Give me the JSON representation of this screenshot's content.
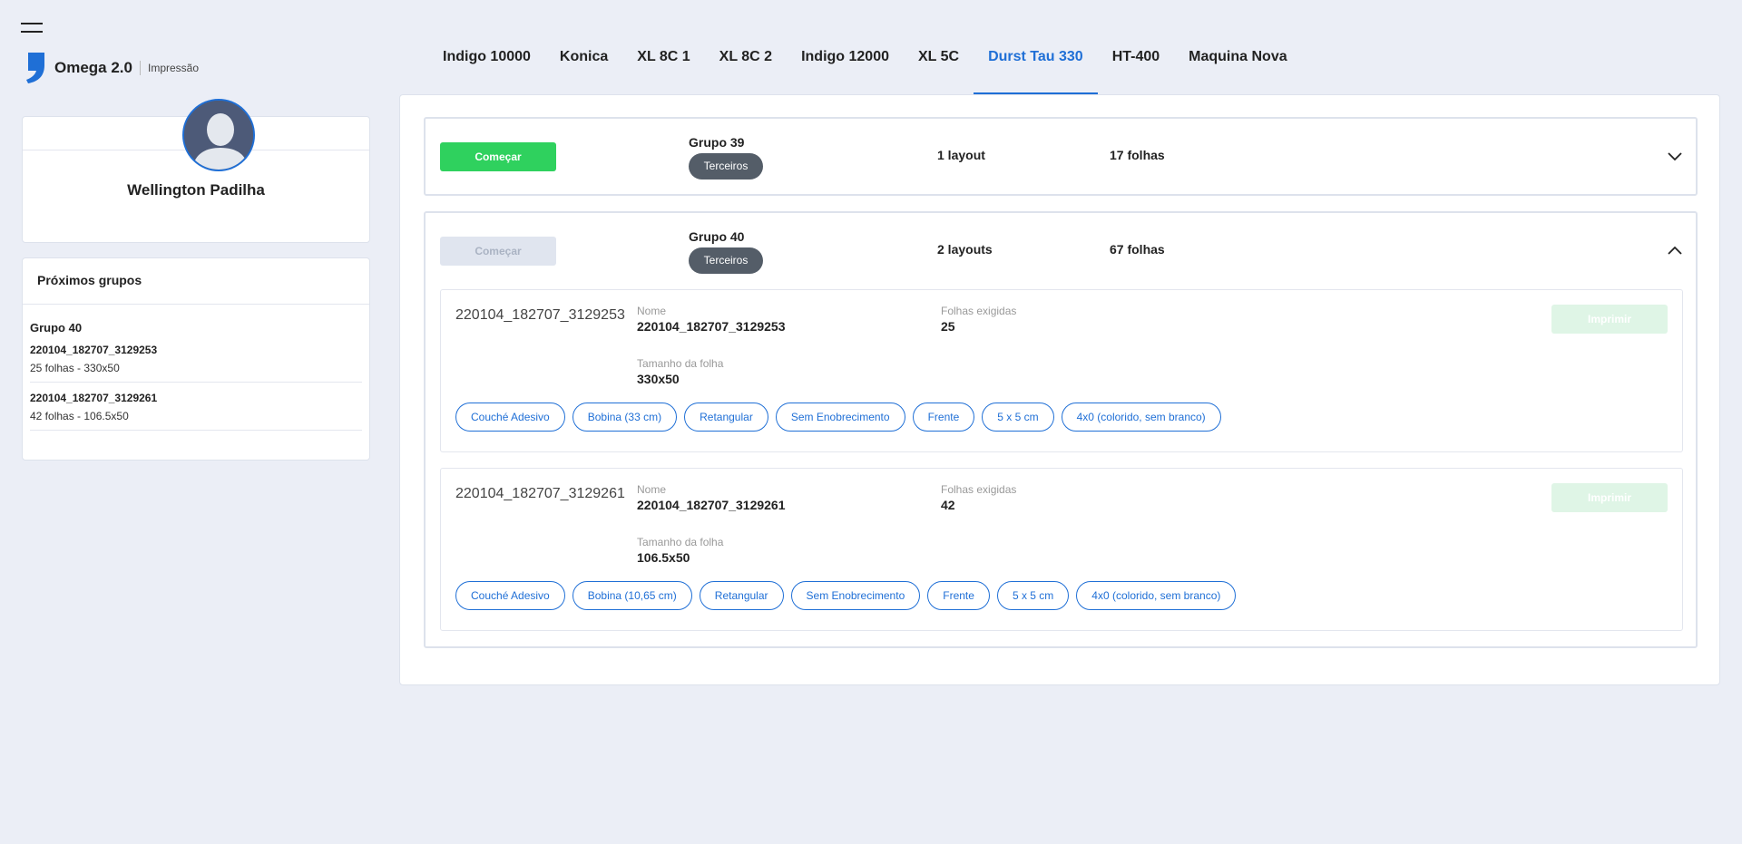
{
  "brand": {
    "name": "Omega 2.0",
    "sub": "Impressão"
  },
  "tabs": [
    {
      "label": "Indigo 10000"
    },
    {
      "label": "Konica"
    },
    {
      "label": "XL 8C 1"
    },
    {
      "label": "XL 8C 2"
    },
    {
      "label": "Indigo 12000"
    },
    {
      "label": "XL 5C"
    },
    {
      "label": "Durst Tau 330",
      "active": true
    },
    {
      "label": "HT-400"
    },
    {
      "label": "Maquina Nova"
    }
  ],
  "profile": {
    "name": "Wellington Padilha"
  },
  "next_groups": {
    "title": "Próximos grupos",
    "group": "Grupo 40",
    "items": [
      {
        "title": "220104_182707_3129253",
        "subtitle": "25 folhas - 330x50"
      },
      {
        "title": "220104_182707_3129261",
        "subtitle": "42 folhas - 106.5x50"
      }
    ]
  },
  "groups": [
    {
      "start_label": "Começar",
      "title": "Grupo 39",
      "badge": "Terceiros",
      "layouts": "1 layout",
      "folhas": "17 folhas",
      "expanded": false
    },
    {
      "start_label": "Começar",
      "title": "Grupo 40",
      "badge": "Terceiros",
      "layouts": "2 layouts",
      "folhas": "67 folhas",
      "expanded": true,
      "layout_items": [
        {
          "image_alt": "220104_182707_3129253",
          "name_label": "Nome",
          "name": "220104_182707_3129253",
          "folhas_label": "Folhas exigidas",
          "folhas": "25",
          "size_label": "Tamanho da folha",
          "size": "330x50",
          "print_label": "Imprimir",
          "chips": [
            "Couché Adesivo",
            "Bobina (33 cm)",
            "Retangular",
            "Sem Enobrecimento",
            "Frente",
            "5 x 5 cm",
            "4x0 (colorido, sem branco)"
          ]
        },
        {
          "image_alt": "220104_182707_3129261",
          "name_label": "Nome",
          "name": "220104_182707_3129261",
          "folhas_label": "Folhas exigidas",
          "folhas": "42",
          "size_label": "Tamanho da folha",
          "size": "106.5x50",
          "print_label": "Imprimir",
          "chips": [
            "Couché Adesivo",
            "Bobina (10,65 cm)",
            "Retangular",
            "Sem Enobrecimento",
            "Frente",
            "5 x 5 cm",
            "4x0 (colorido, sem branco)"
          ]
        }
      ]
    }
  ],
  "colors": {
    "accent": "#1f6fd6",
    "start": "#2fd15e",
    "badge": "#545d68",
    "background": "#ebeef6"
  }
}
